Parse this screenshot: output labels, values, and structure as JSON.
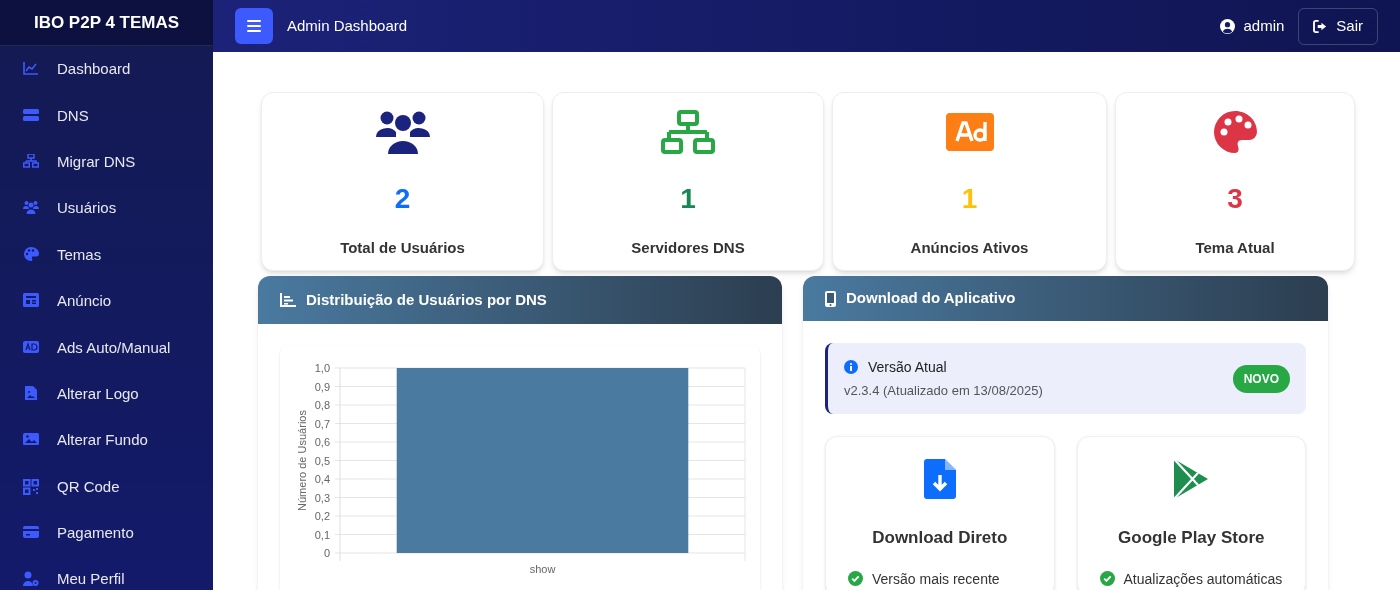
{
  "sidebar": {
    "brand": "IBO P2P 4 TEMAS",
    "items": [
      {
        "label": "Dashboard"
      },
      {
        "label": "DNS"
      },
      {
        "label": "Migrar DNS"
      },
      {
        "label": "Usuários"
      },
      {
        "label": "Temas"
      },
      {
        "label": "Anúncio"
      },
      {
        "label": "Ads Auto/Manual"
      },
      {
        "label": "Alterar Logo"
      },
      {
        "label": "Alterar Fundo"
      },
      {
        "label": "QR Code"
      },
      {
        "label": "Pagamento"
      },
      {
        "label": "Meu Perfil"
      }
    ]
  },
  "topbar": {
    "title": "Admin Dashboard",
    "user": "admin",
    "logout": "Sair"
  },
  "stats": [
    {
      "value": "2",
      "label": "Total de Usuários",
      "color": "#0d6efd"
    },
    {
      "value": "1",
      "label": "Servidores DNS",
      "color": "#198754"
    },
    {
      "value": "1",
      "label": "Anúncios Ativos",
      "color": "#ffc107"
    },
    {
      "value": "3",
      "label": "Tema Atual",
      "color": "#dc3545"
    }
  ],
  "chart_panel": {
    "title": "Distribuição de Usuários por DNS",
    "chart_data": {
      "type": "bar",
      "ylabel": "Número de Usuários",
      "categories": [
        "show"
      ],
      "series": [
        {
          "color": "#4a7aa0",
          "values": [
            1
          ]
        }
      ],
      "grid": true,
      "ylim": [
        0,
        1
      ],
      "yticks": [
        {
          "value": 0,
          "label": "0"
        },
        {
          "value": 0.1,
          "label": "0,1"
        },
        {
          "value": 0.2,
          "label": "0,2"
        },
        {
          "value": 0.3,
          "label": "0,3"
        },
        {
          "value": 0.4,
          "label": "0,4"
        },
        {
          "value": 0.5,
          "label": "0,5"
        },
        {
          "value": 0.6,
          "label": "0,6"
        },
        {
          "value": 0.7,
          "label": "0,7"
        },
        {
          "value": 0.8,
          "label": "0,8"
        },
        {
          "value": 0.9,
          "label": "0,9"
        },
        {
          "value": 1,
          "label": "1,0"
        }
      ]
    }
  },
  "download_panel": {
    "title": "Download do Aplicativo",
    "version": {
      "title": "Versão Atual",
      "detail": "v2.3.4 (Atualizado em 13/08/2025)",
      "badge": "NOVO"
    },
    "options": [
      {
        "title": "Download Direto",
        "features": [
          "Versão mais recente"
        ]
      },
      {
        "title": "Google Play Store",
        "features": [
          "Atualizações automáticas"
        ]
      }
    ]
  }
}
